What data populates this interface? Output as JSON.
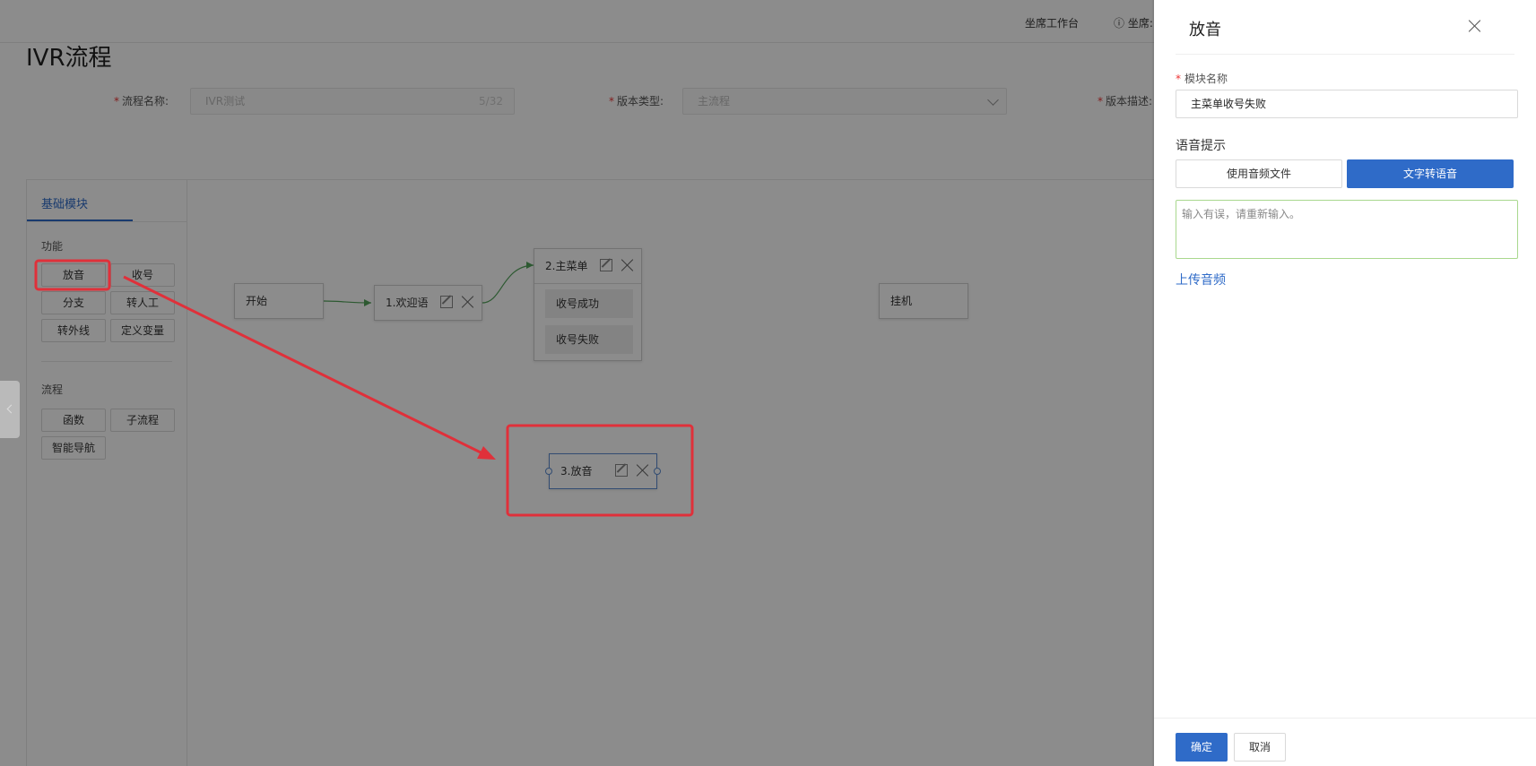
{
  "topbar": {
    "workbench_label": "坐席工作台",
    "agent_label": "坐席:"
  },
  "page": {
    "title": "IVR流程"
  },
  "form": {
    "flow_name_label": "流程名称:",
    "flow_name_value": "IVR测试",
    "flow_name_count": "5/32",
    "version_type_label": "版本类型:",
    "version_type_value": "主流程",
    "version_desc_label": "版本描述:"
  },
  "palette": {
    "tab_label": "基础模块",
    "section_function": "功能",
    "btn_play": "放音",
    "btn_collect": "收号",
    "btn_branch": "分支",
    "btn_transfer_agent": "转人工",
    "btn_transfer_line": "转外线",
    "btn_define_var": "定义变量",
    "section_flow": "流程",
    "btn_function": "函数",
    "btn_subflow": "子流程",
    "btn_smart_nav": "智能导航"
  },
  "canvas": {
    "node_start": "开始",
    "node_welcome": "1.欢迎语",
    "node_menu": "2.主菜单",
    "menu_success": "收号成功",
    "menu_fail": "收号失败",
    "node_hangup": "挂机",
    "node_play": "3.放音"
  },
  "drawer": {
    "title": "放音",
    "module_name_label": "模块名称",
    "module_name_value": "主菜单收号失败",
    "voice_prompt_label": "语音提示",
    "seg_audio_file": "使用音频文件",
    "seg_tts": "文字转语音",
    "tts_text": "输入有误，请重新输入。",
    "upload_link": "上传音频",
    "confirm_label": "确定",
    "cancel_label": "取消"
  },
  "colors": {
    "primary": "#2f6bc8",
    "annotation": "#e0303a",
    "connector": "#52a35a"
  }
}
